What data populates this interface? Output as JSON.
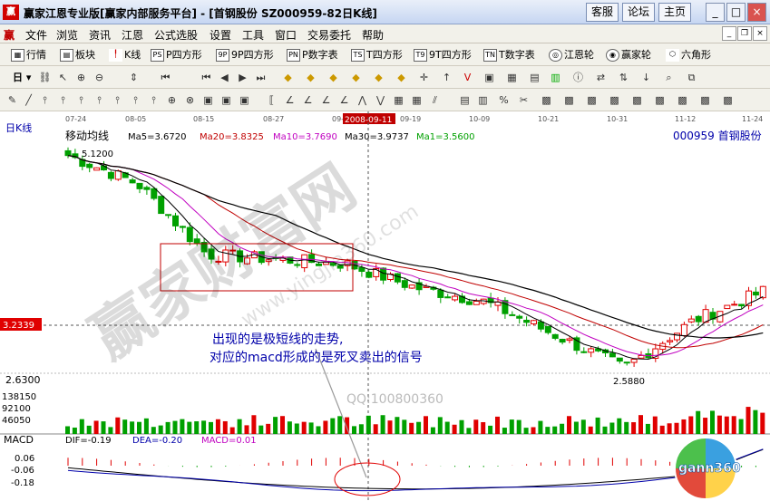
{
  "window": {
    "title": "赢家江恩专业版[赢家内部服务平台] - [首钢股份  SZ000959-82日K线]",
    "logo": "赢",
    "buttons": [
      "客服",
      "论坛",
      "主页"
    ]
  },
  "menu": {
    "logo": "赢",
    "items": [
      "文件",
      "浏览",
      "资讯",
      "江恩",
      "公式选股",
      "设置",
      "工具",
      "窗口",
      "交易委托",
      "帮助"
    ]
  },
  "toolbar1": [
    {
      "icon": "grid-icon",
      "label": "行情"
    },
    {
      "icon": "blocks-icon",
      "label": "板块"
    },
    {
      "icon": "kline-icon",
      "label": "K线"
    },
    {
      "icon": "PS",
      "label": "P四方形"
    },
    {
      "icon": "9P",
      "label": "9P四方形"
    },
    {
      "icon": "PN",
      "label": "P数字表"
    },
    {
      "icon": "TS",
      "label": "T四方形"
    },
    {
      "icon": "T9",
      "label": "9T四方形"
    },
    {
      "icon": "TN",
      "label": "T数字表"
    },
    {
      "icon": "wheel-icon",
      "label": "江恩轮"
    },
    {
      "icon": "wheel-icon",
      "label": "赢家轮"
    },
    {
      "icon": "hexagon-icon",
      "label": "六角形"
    }
  ],
  "toolbar2": {
    "period": "日"
  },
  "chart": {
    "period_label": "日K线",
    "indicator_title": "移动均线",
    "ma_labels": [
      {
        "text": "Ma5=3.6720",
        "color": "#000000"
      },
      {
        "text": "Ma20=3.8325",
        "color": "#c00000"
      },
      {
        "text": "Ma10=3.7690",
        "color": "#c000c0"
      },
      {
        "text": "Ma30=3.9737",
        "color": "#000000"
      },
      {
        "text": "Ma1=3.5600",
        "color": "#00a000"
      }
    ],
    "stock_label": "000959 首钢股份",
    "date_ticks": [
      "07-24",
      "08-05",
      "08-15",
      "08-27",
      "09-08",
      "09-19",
      "10-09",
      "10-21",
      "10-31",
      "11-12",
      "11-24"
    ],
    "cursor_date": "2008-09-11",
    "price_high_label": "5.1200",
    "price_low_label": "2.5880",
    "cursor_price": "3.2339",
    "price_axis": [
      "2.6300"
    ],
    "volume_axis": [
      "138150",
      "92100",
      "46050"
    ],
    "annotation_line1": "出现的是极短线的走势,",
    "annotation_line2": "对应的macd形成的是死叉卖出的信号",
    "watermark_text": "赢家财富网",
    "watermark_url": "www.yingjia360.com",
    "qq_text": "QQ:100800360",
    "macd": {
      "title": "MACD",
      "dif": "DIF=-0.19",
      "dea": "DEA=-0.20",
      "macd": "MACD=0.01",
      "axis": [
        "0.06",
        "-0.06",
        "-0.18"
      ]
    },
    "gann_logo": "gann360",
    "colors": {
      "up": "#e00000",
      "down": "#00a000",
      "accent": "#e00000"
    }
  },
  "chart_data": {
    "type": "candlestick",
    "symbol": "SZ000959",
    "name": "首钢股份",
    "x": [
      "07-24",
      "08-05",
      "08-15",
      "08-27",
      "09-08",
      "09-19",
      "10-09",
      "10-21",
      "10-31",
      "11-12",
      "11-24"
    ],
    "close_approx": [
      5.0,
      4.7,
      3.95,
      3.9,
      3.85,
      3.6,
      3.45,
      3.1,
      2.75,
      3.25,
      3.56
    ],
    "price_range": [
      2.588,
      5.12
    ],
    "volume_axis": [
      46050,
      92100,
      138150
    ],
    "macd": {
      "dif": -0.19,
      "dea": -0.2,
      "macd": 0.01,
      "ylim": [
        -0.18,
        0.06
      ]
    }
  }
}
